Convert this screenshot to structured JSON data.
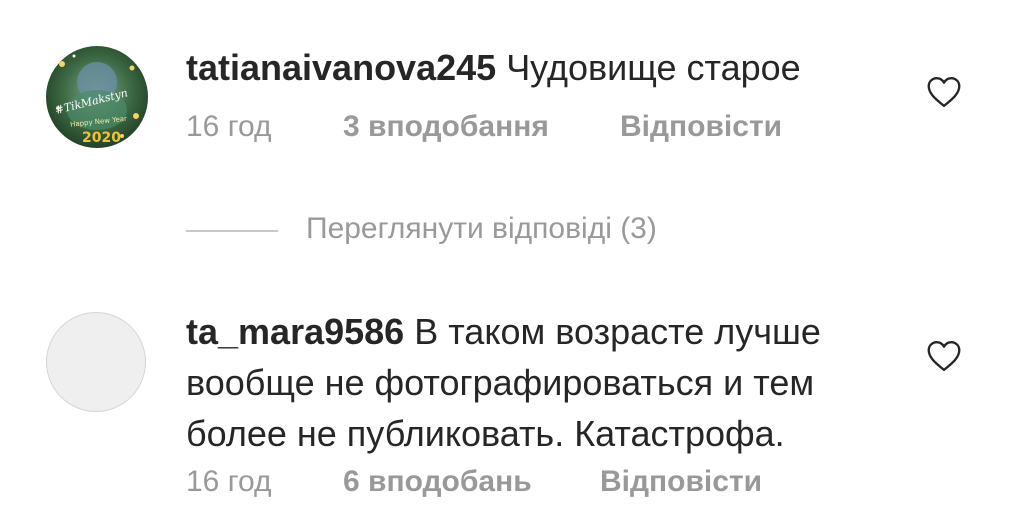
{
  "comments": [
    {
      "username": "tatianaivanova245",
      "text": "Чудовище старое",
      "time": "16 год",
      "likes": "3 вподобання",
      "reply_label": "Відповісти",
      "avatar_overlay_text": "#TikMakstyn Happy New Year 2020",
      "view_replies_label": "Переглянути відповіді (3)"
    },
    {
      "username": "ta_mara9586",
      "text": "В таком возрасте лучше вообще не фотографироваться и тем более не публиковать. Катастрофа.",
      "time": "16 год",
      "likes": "6 вподобань",
      "reply_label": "Відповісти"
    }
  ],
  "icons": {
    "like": "heart-outline-icon"
  },
  "colors": {
    "text_primary": "#262626",
    "text_secondary": "#999999",
    "divider": "#c7c7c7"
  }
}
